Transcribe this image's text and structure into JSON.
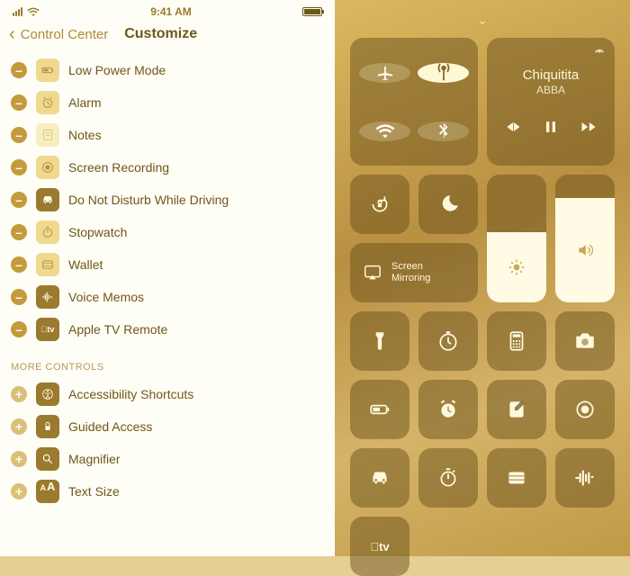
{
  "status": {
    "time": "9:41 AM"
  },
  "header": {
    "back": "Control Center",
    "title": "Customize"
  },
  "included": [
    {
      "label": "Low Power Mode",
      "icon": "low-power"
    },
    {
      "label": "Alarm",
      "icon": "alarm"
    },
    {
      "label": "Notes",
      "icon": "notes"
    },
    {
      "label": "Screen Recording",
      "icon": "screen-recording"
    },
    {
      "label": "Do Not Disturb While Driving",
      "icon": "car"
    },
    {
      "label": "Stopwatch",
      "icon": "stopwatch"
    },
    {
      "label": "Wallet",
      "icon": "wallet"
    },
    {
      "label": "Voice Memos",
      "icon": "voice-memos"
    },
    {
      "label": "Apple TV Remote",
      "icon": "apple-tv"
    }
  ],
  "more_header": "MORE CONTROLS",
  "more": [
    {
      "label": "Accessibility Shortcuts",
      "icon": "accessibility"
    },
    {
      "label": "Guided Access",
      "icon": "guided-access"
    },
    {
      "label": "Magnifier",
      "icon": "magnifier"
    },
    {
      "label": "Text Size",
      "icon": "text-size"
    }
  ],
  "control_center": {
    "media": {
      "title": "Chiquitita",
      "artist": "ABBA"
    },
    "mirror_label": "Screen\nMirroring",
    "brightness_pct": 55,
    "volume_pct": 82
  }
}
